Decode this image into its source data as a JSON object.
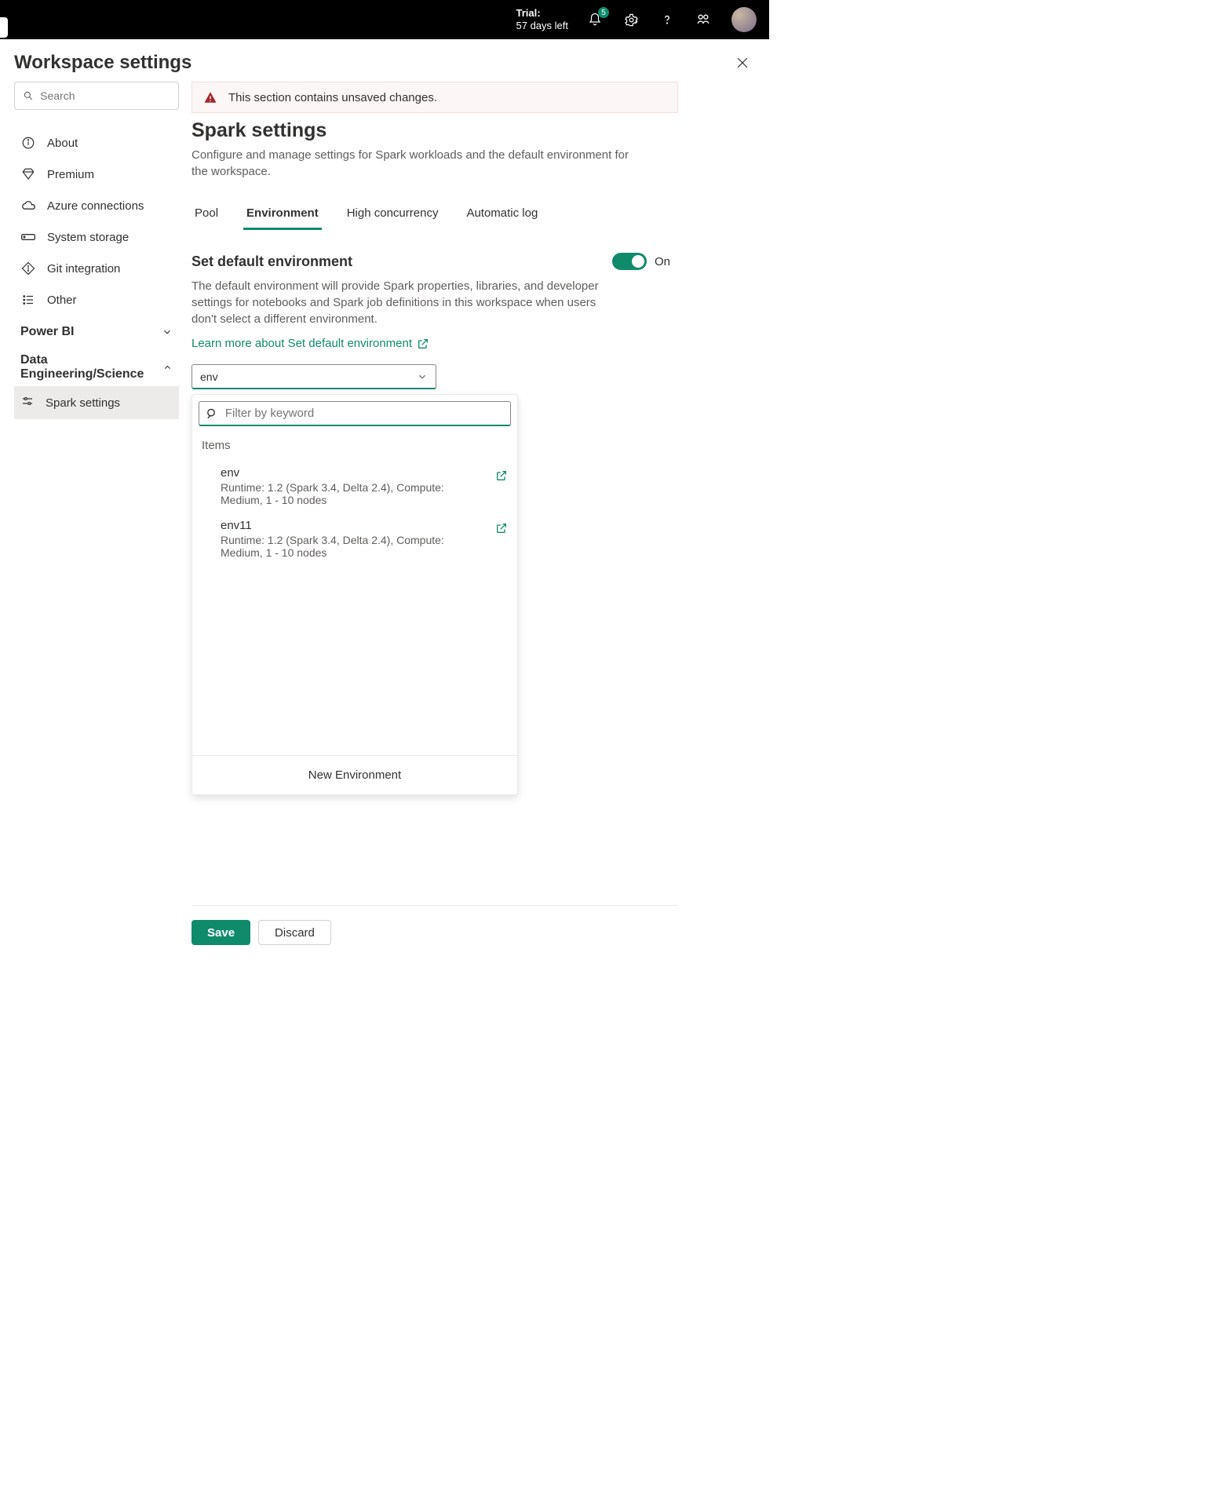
{
  "top": {
    "trial_label": "Trial:",
    "trial_value": "57 days left",
    "badge_count": "5"
  },
  "page_title": "Workspace settings",
  "search_placeholder": "Search",
  "sidebar": {
    "items_main": [
      {
        "label": "About"
      },
      {
        "label": "Premium"
      },
      {
        "label": "Azure connections"
      },
      {
        "label": "System storage"
      },
      {
        "label": "Git integration"
      },
      {
        "label": "Other"
      }
    ],
    "section_powerbi": "Power BI",
    "section_des": "Data Engineering/Science",
    "subitem_spark": "Spark settings"
  },
  "alert_text": "This section contains unsaved changes.",
  "spark": {
    "title": "Spark settings",
    "desc": "Configure and manage settings for Spark workloads and the default environment for the workspace."
  },
  "tabs": {
    "pool": "Pool",
    "environment": "Environment",
    "high_concurrency": "High concurrency",
    "automatic_log": "Automatic log"
  },
  "env": {
    "heading": "Set default environment",
    "toggle_label": "On",
    "desc": "The default environment will provide Spark properties, libraries, and developer settings for notebooks and Spark job definitions in this workspace when users don't select a different environment.",
    "learn_link": "Learn more about Set default environment",
    "dropdown_value": "env",
    "filter_placeholder": "Filter by keyword",
    "items_label": "Items",
    "list": [
      {
        "name": "env",
        "meta": "Runtime: 1.2 (Spark 3.4, Delta 2.4), Compute: Medium, 1 - 10 nodes"
      },
      {
        "name": "env11",
        "meta": "Runtime: 1.2 (Spark 3.4, Delta 2.4), Compute: Medium, 1 - 10 nodes"
      }
    ],
    "new_env": "New Environment"
  },
  "buttons": {
    "save": "Save",
    "discard": "Discard"
  }
}
